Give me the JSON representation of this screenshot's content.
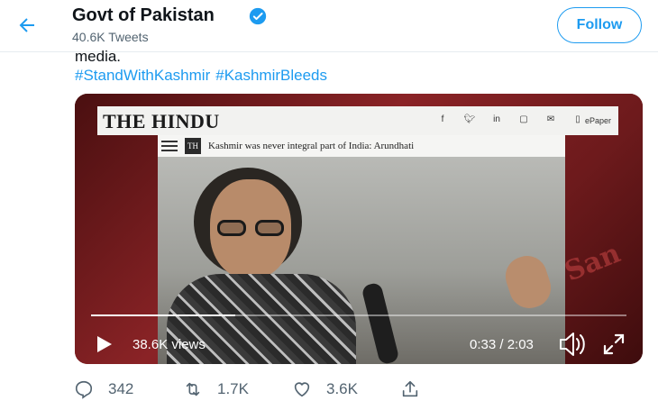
{
  "header": {
    "account_name": "Govt of Pakistan",
    "tweet_count": "40.6K Tweets",
    "follow_label": "Follow"
  },
  "tweet": {
    "text_tail": "media.",
    "hashtags": [
      "#StandWithKashmir",
      "#KashmirBleeds"
    ]
  },
  "video": {
    "newspaper_logo": "THE HINDU",
    "epaper_label": "ePaper",
    "social_icons": [
      "f",
      "t",
      "in",
      "ig",
      "mail",
      "phone"
    ],
    "th_logo": "TH",
    "headline": "Kashmir was never integral part of India: Arundhati",
    "views": "38.6K views",
    "time": "0:33 / 2:03",
    "progress_fraction": 0.27
  },
  "actions": {
    "replies": "342",
    "retweets": "1.7K",
    "likes": "3.6K"
  },
  "colors": {
    "accent": "#1d9bf0",
    "text": "#0f1419",
    "muted": "#536471"
  }
}
